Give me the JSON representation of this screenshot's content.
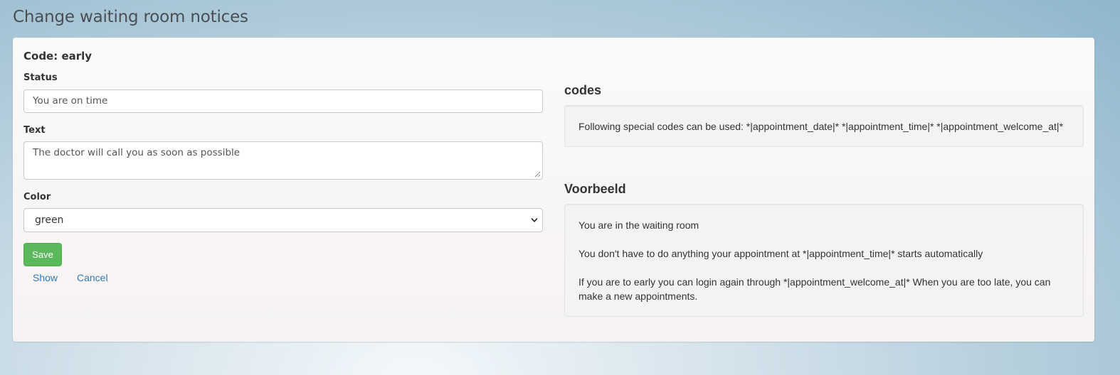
{
  "page": {
    "title": "Change waiting room notices"
  },
  "form": {
    "code_heading": "Code: early",
    "status": {
      "label": "Status",
      "value": "You are on time"
    },
    "text": {
      "label": "Text",
      "value": "The doctor will call you as soon as possible"
    },
    "color": {
      "label": "Color",
      "selected": "green"
    },
    "save_label": "Save",
    "show_label": "Show",
    "cancel_label": "Cancel"
  },
  "codes": {
    "title": "codes",
    "text": "Following special codes can be used: *|appointment_date|* *|appointment_time|* *|appointment_welcome_at|*"
  },
  "preview": {
    "title": "Voorbeeld",
    "line1": "You are in the waiting room",
    "line2": "You don't have to do anything your appointment at *|appointment_time|* starts automatically",
    "line3": "If you are to early you can login again through *|appointment_welcome_at|* When you are too late, you can make a new appointments."
  },
  "colors": {
    "save_button": "#5cb85c",
    "link": "#337ab7"
  },
  "icons": {
    "select_arrow": "chevron-down-icon",
    "textarea_resize": "resize-grip-icon"
  }
}
